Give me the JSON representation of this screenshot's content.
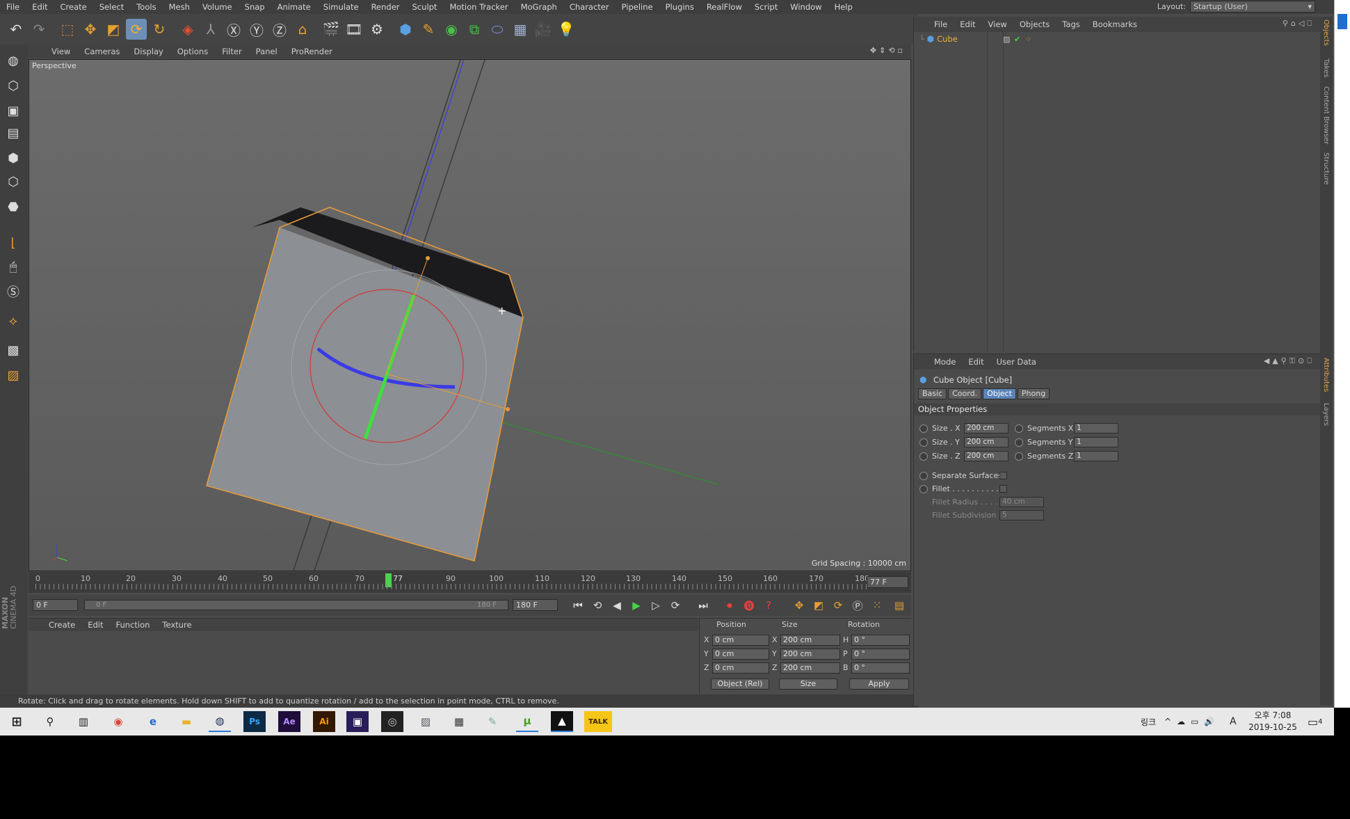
{
  "menu": [
    "File",
    "Edit",
    "Create",
    "Select",
    "Tools",
    "Mesh",
    "Volume",
    "Snap",
    "Animate",
    "Simulate",
    "Render",
    "Sculpt",
    "Motion Tracker",
    "MoGraph",
    "Character",
    "Pipeline",
    "Plugins",
    "RealFlow",
    "Script",
    "Window",
    "Help"
  ],
  "layout": {
    "label": "Layout:",
    "value": "Startup (User)"
  },
  "viewport": {
    "menu": [
      "View",
      "Cameras",
      "Display",
      "Options",
      "Filter",
      "Panel",
      "ProRender"
    ],
    "label": "Perspective",
    "grid_spacing": "Grid Spacing : 10000 cm"
  },
  "timeline": {
    "ticks": [
      "0",
      "10",
      "20",
      "30",
      "40",
      "50",
      "60",
      "70",
      "80",
      "90",
      "100",
      "110",
      "120",
      "130",
      "140",
      "150",
      "160",
      "170",
      "180"
    ],
    "marker_label": "77",
    "current_frame": "77 F",
    "start_frame": "0 F",
    "range_start": "0 F",
    "range_end": "180 F",
    "end_frame": "180 F"
  },
  "material_menu": [
    "Create",
    "Edit",
    "Function",
    "Texture"
  ],
  "coords": {
    "headers": {
      "position": "Position",
      "size": "Size",
      "rotation": "Rotation"
    },
    "rows": [
      {
        "axis": "X",
        "pos": "0 cm",
        "saxis": "X",
        "size": "200 cm",
        "raxis": "H",
        "rot": "0 °"
      },
      {
        "axis": "Y",
        "pos": "0 cm",
        "saxis": "Y",
        "size": "200 cm",
        "raxis": "P",
        "rot": "0 °"
      },
      {
        "axis": "Z",
        "pos": "0 cm",
        "saxis": "Z",
        "size": "200 cm",
        "raxis": "B",
        "rot": "0 °"
      }
    ],
    "mode": "Object (Rel)",
    "size_mode": "Size",
    "apply": "Apply"
  },
  "status": "Rotate: Click and drag to rotate elements. Hold down SHIFT to add to quantize rotation / add to the selection in point mode, CTRL to remove.",
  "brand": {
    "maxon": "MAXON",
    "product": "CINEMA 4D"
  },
  "object_manager": {
    "menu": [
      "File",
      "Edit",
      "View",
      "Objects",
      "Tags",
      "Bookmarks"
    ],
    "objects": [
      {
        "name": "Cube"
      }
    ]
  },
  "attributes": {
    "menu": [
      "Mode",
      "Edit",
      "User Data"
    ],
    "title": "Cube Object [Cube]",
    "tabs": [
      "Basic",
      "Coord.",
      "Object",
      "Phong"
    ],
    "active_tab": "Object",
    "section": "Object Properties",
    "size": [
      {
        "label": "Size . X",
        "value": "200 cm",
        "seg_label": "Segments X",
        "seg_value": "1"
      },
      {
        "label": "Size . Y",
        "value": "200 cm",
        "seg_label": "Segments Y",
        "seg_value": "1"
      },
      {
        "label": "Size . Z",
        "value": "200 cm",
        "seg_label": "Segments Z",
        "seg_value": "1"
      }
    ],
    "separate_surfaces": "Separate Surfaces",
    "fillet": "Fillet . . . . . . . . . .",
    "fillet_radius": {
      "label": "Fillet Radius . . . .",
      "value": "40 cm"
    },
    "fillet_subdivision": {
      "label": "Fillet Subdivision",
      "value": "5"
    }
  },
  "right_tabs": [
    "Objects",
    "Takes",
    "Content Browser",
    "Structure",
    "Attributes",
    "Layers"
  ],
  "taskbar": {
    "apps": [
      "Ps",
      "Ae",
      "Ai"
    ],
    "tray_lang": "링크",
    "ime": "A",
    "time": "오후 7:08",
    "date": "2019-10-25",
    "notifications": "4"
  },
  "colors": {
    "accent": "#5b83b8",
    "selection": "#e69b3c",
    "axis_green": "#3ee03e",
    "axis_blue": "#3a3ae6",
    "axis_red": "#d23a3a"
  }
}
